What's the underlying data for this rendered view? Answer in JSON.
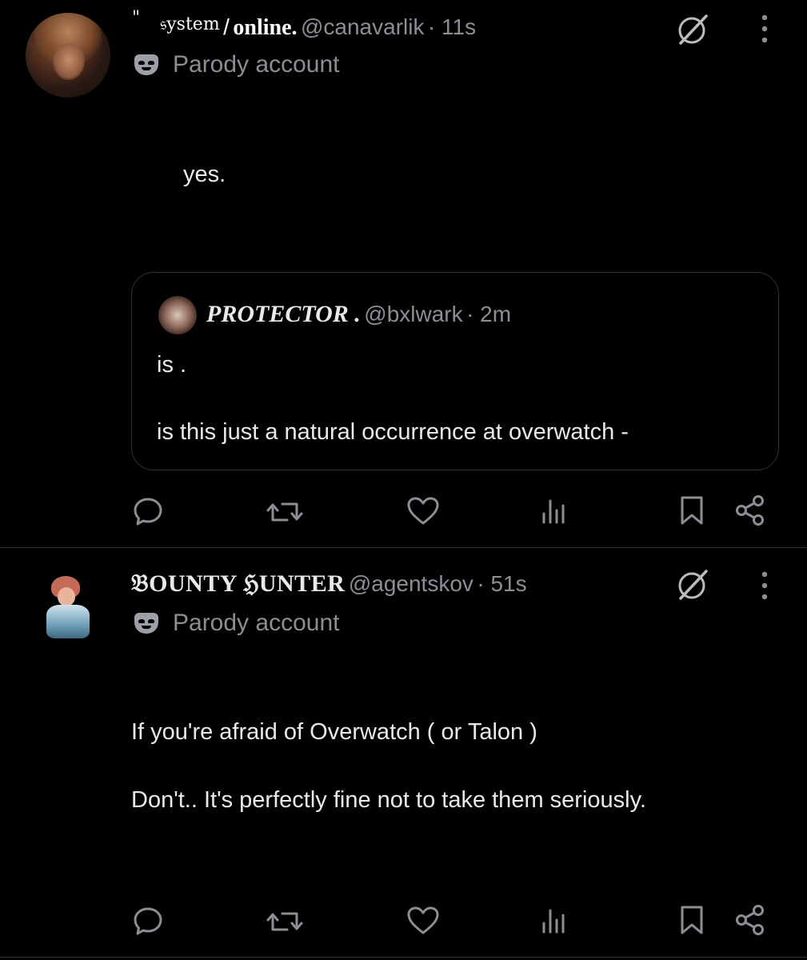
{
  "posts": [
    {
      "quote_glyph": "\"",
      "display_name_sup": "𝔰ystem",
      "display_name_slash": "/",
      "display_name_main": "online.",
      "handle": "@canavarlik",
      "time": "· 11s",
      "parody_label": "Parody account",
      "text": "yes.",
      "quoted": {
        "display_name": "PROTECTOR .",
        "handle": "@bxlwark",
        "time": "· 2m",
        "line1": "is .",
        "line2": "is this just a natural occurrence at overwatch -"
      },
      "icons": [
        "reply-icon",
        "repost-icon",
        "like-icon",
        "views-icon",
        "bookmark-icon",
        "share-icon"
      ]
    },
    {
      "display_name": "𝔅OUNTY ℌUNTER",
      "handle": "@agentskov",
      "time": "· 51s",
      "parody_label": "Parody account",
      "text_line1": "If you're afraid of Overwatch ( or Talon )",
      "text_line2": "Don't.. It's perfectly fine not to take them seriously.",
      "icons": [
        "reply-icon",
        "repost-icon",
        "like-icon",
        "views-icon",
        "bookmark-icon",
        "share-icon"
      ]
    }
  ],
  "colors": {
    "background": "#000000",
    "text": "#e7e9ea",
    "muted": "#8b8f94",
    "border": "#2f3336"
  }
}
